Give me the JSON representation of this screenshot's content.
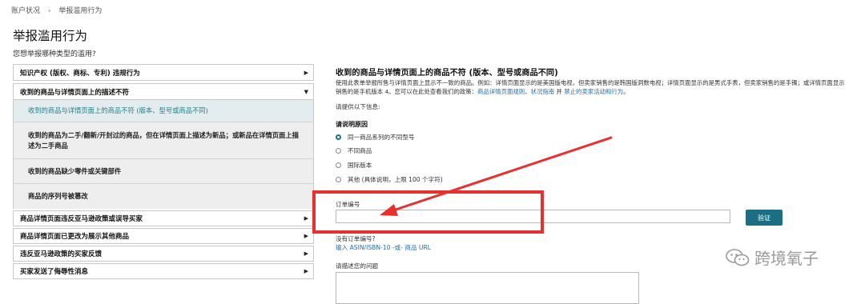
{
  "breadcrumb": {
    "parent": "账户状况",
    "separator": "›",
    "current": "举报滥用行为"
  },
  "page": {
    "title": "举报滥用行为",
    "subtitle": "您想举报哪种类型的滥用?"
  },
  "menu": {
    "items": [
      {
        "label": "知识产权 (版权、商标、专利) 违规行为",
        "arrow": "▶"
      },
      {
        "label": "收到的商品与详情页面上的描述不符",
        "arrow": "▼"
      }
    ],
    "subitems": [
      "收到的商品与详情页面上的商品不符 (版本、型号或商品不同)",
      "收到的商品为二手/翻新/开封过的商品，但在详情页面上描述为新品；或新品在详情页面上描述为二手商品",
      "收到的商品缺少零件或关键部件",
      "商品的序列号被篡改"
    ],
    "more_items": [
      {
        "label": "商品详情页面违反亚马逊政策或误导买家",
        "arrow": "▶"
      },
      {
        "label": "商品详情页面已更改为展示其他商品",
        "arrow": "▶"
      },
      {
        "label": "违反亚马逊政策的买家反馈",
        "arrow": "▶"
      },
      {
        "label": "买家发送了侮辱性消息",
        "arrow": "▶"
      }
    ]
  },
  "form": {
    "title": "收到的商品与详情页面上的商品不符 (版本、型号或商品不同)",
    "desc_line1": "使用此表单举报所售与详情页面上显示不一致的商品。例如：详情页面显示的是美国版电视，但卖家销售的是韩国版洞数电视；详情页面显示的是男式手表，但卖家销售的是手镯；或详情页面显示",
    "desc_line2_prefix": "销售的是手机版本 4。您可以在此处查看我们的政策：",
    "desc_link1": "商品详情页面规则",
    "desc_link_sep1": "、",
    "desc_link2": "状况指南",
    "desc_link_sep2": " 并 ",
    "desc_link3": "禁止的卖家活动和行为",
    "desc_end": "。",
    "prompt": "请提供以下信息:",
    "reason_heading": "请说明原因",
    "reasons": [
      "同一商品系列的不同型号",
      "不同商品",
      "国际版本",
      "其他 (具体说明，上限 100 个字符)"
    ],
    "order_label": "订单编号",
    "verify_label": "验证",
    "no_order": "没有订单编号?",
    "no_order_link": "输入 ASIN/ISBN-10 -或- 商品 URL",
    "describe_label": "请描述您的问题"
  },
  "watermark": {
    "text": "跨境氧子",
    "icon": "wechat-icon"
  },
  "colors": {
    "accent": "#1b6e83",
    "link": "#1a6fb5",
    "annotation": "#e8302e",
    "active_item": "#2c7d8a"
  }
}
